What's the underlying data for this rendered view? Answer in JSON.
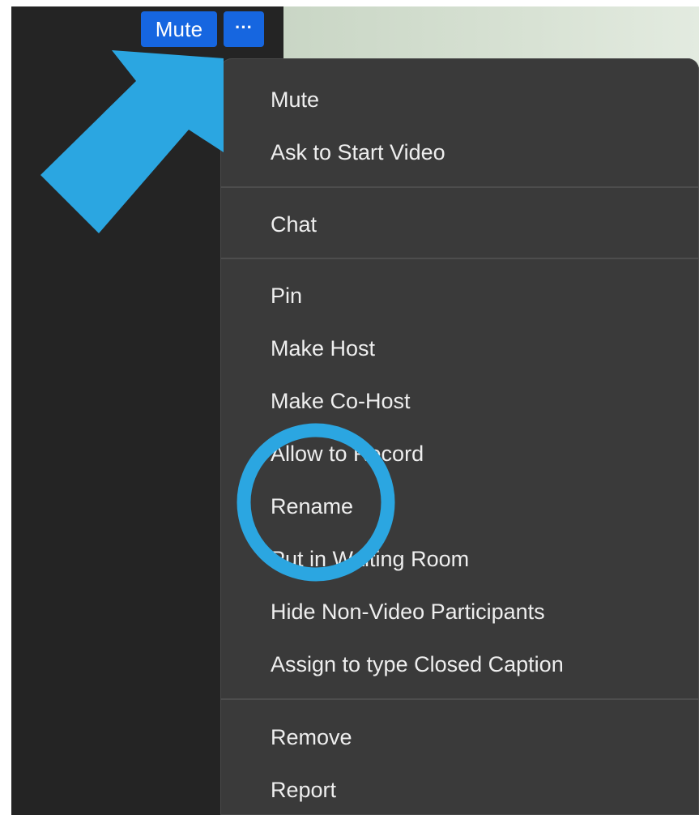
{
  "participant_controls": {
    "mute_label": "Mute",
    "more_label": "···"
  },
  "context_menu": {
    "items": [
      {
        "label": "Mute"
      },
      {
        "label": "Ask to Start Video"
      },
      {
        "label": "Chat"
      },
      {
        "label": "Pin"
      },
      {
        "label": "Make Host"
      },
      {
        "label": "Make Co-Host"
      },
      {
        "label": "Allow to Record"
      },
      {
        "label": "Rename"
      },
      {
        "label": "Put in Waiting Room"
      },
      {
        "label": "Hide Non-Video Participants"
      },
      {
        "label": "Assign to type Closed Caption"
      },
      {
        "label": "Remove"
      },
      {
        "label": "Report"
      }
    ]
  },
  "colors": {
    "accent_blue": "#1666e0",
    "annotation_blue": "#2ba6e1",
    "menu_bg": "#3a3a3a",
    "panel_bg": "#242424"
  },
  "icons": {
    "annotation_arrow": "arrow-pointer-icon",
    "annotation_circle": "highlight-circle-icon"
  }
}
